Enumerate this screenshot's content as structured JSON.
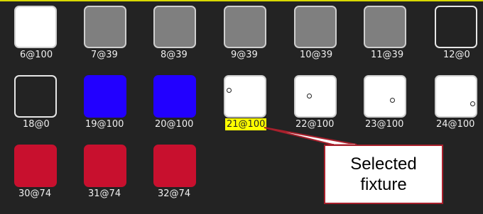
{
  "fixtures": [
    {
      "label": "6@100",
      "style": "white"
    },
    {
      "label": "7@39",
      "style": "gray"
    },
    {
      "label": "8@39",
      "style": "gray"
    },
    {
      "label": "9@39",
      "style": "gray"
    },
    {
      "label": "10@39",
      "style": "gray"
    },
    {
      "label": "11@39",
      "style": "gray"
    },
    {
      "label": "12@0",
      "style": "dark"
    },
    {
      "label": "18@0",
      "style": "dark"
    },
    {
      "label": "19@100",
      "style": "blue"
    },
    {
      "label": "20@100",
      "style": "blue"
    },
    {
      "label": "21@100",
      "style": "white",
      "selected": true
    },
    {
      "label": "22@100",
      "style": "white"
    },
    {
      "label": "23@100",
      "style": "white"
    },
    {
      "label": "24@100",
      "style": "white"
    },
    {
      "label": "30@74",
      "style": "red"
    },
    {
      "label": "31@74",
      "style": "red"
    },
    {
      "label": "32@74",
      "style": "red"
    }
  ],
  "callout": {
    "line1": "Selected",
    "line2": "fixture"
  },
  "colors": {
    "accent": "#ffff00",
    "callout_border": "#a8202c",
    "blue": "#2200ff",
    "red": "#c8102e"
  }
}
